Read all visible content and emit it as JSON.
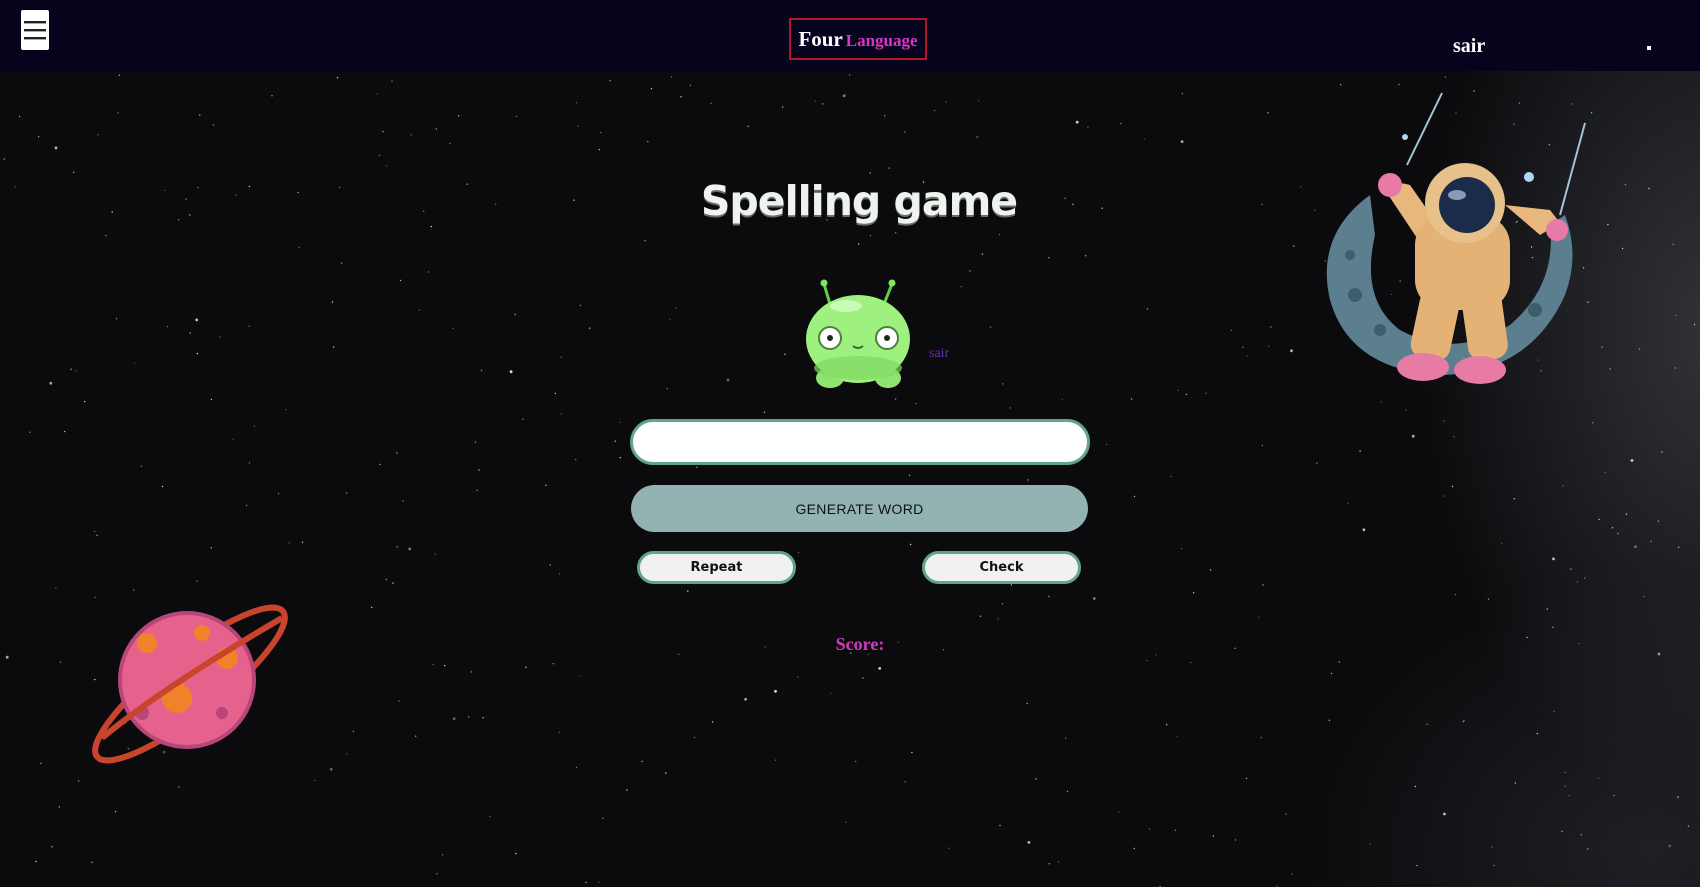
{
  "header": {
    "menu_icon": "hamburger-icon",
    "logo_part1": "Four",
    "logo_part2": "Language",
    "user_name": "sair"
  },
  "game": {
    "title": "Spelling game",
    "mascot_word": "sair",
    "input_value": "",
    "input_placeholder": "",
    "generate_label": "GENERATE WORD",
    "repeat_label": "Repeat",
    "check_label": "Check",
    "score_label": "Score:"
  },
  "colors": {
    "topbar": "#06041c",
    "logo_border": "#b1162a",
    "accent_magenta": "#d836c6",
    "input_border": "#5fa586",
    "generate_bg": "#93b2b2",
    "mascot_word": "#6d2bb3"
  },
  "decorations": {
    "alien": "alien-mascot-icon",
    "astronaut": "astronaut-on-moon-illustration",
    "planet": "ringed-planet-illustration"
  }
}
